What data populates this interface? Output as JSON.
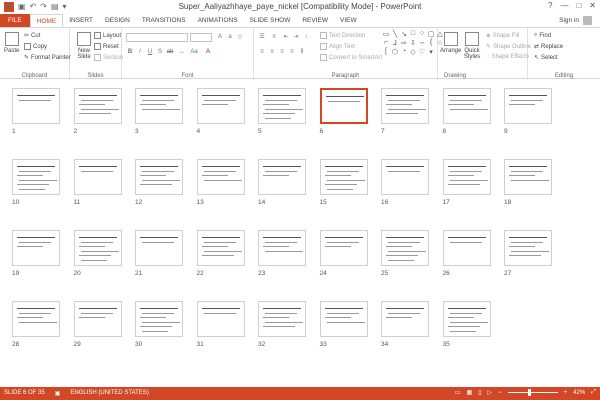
{
  "app": {
    "title": "Super_Aaliyazhhaye_paye_nickel [Compatibility Mode] - PowerPoint",
    "win_controls": [
      "?",
      "—",
      "□",
      "✕"
    ]
  },
  "tabs": [
    "FILE",
    "HOME",
    "INSERT",
    "DESIGN",
    "TRANSITIONS",
    "ANIMATIONS",
    "SLIDE SHOW",
    "REVIEW",
    "VIEW"
  ],
  "signin": "Sign in",
  "ribbon": {
    "clipboard": {
      "label": "Clipboard",
      "paste": "Paste",
      "cut": "Cut",
      "copy": "Copy",
      "format_painter": "Format Painter"
    },
    "slides": {
      "label": "Slides",
      "new_slide": "New Slide",
      "layout": "Layout",
      "reset": "Reset",
      "section": "Section"
    },
    "font": {
      "label": "Font"
    },
    "paragraph": {
      "label": "Paragraph",
      "text_direction": "Text Direction",
      "align_text": "Align Text",
      "convert_smartart": "Convert to SmartArt"
    },
    "drawing": {
      "label": "Drawing",
      "arrange": "Arrange",
      "quick_styles": "Quick Styles",
      "shape_fill": "Shape Fill",
      "shape_outline": "Shape Outline",
      "shape_effects": "Shape Effects"
    },
    "editing": {
      "label": "Editing",
      "find": "Find",
      "replace": "Replace",
      "select": "Select"
    }
  },
  "slides": [
    "1",
    "2",
    "3",
    "4",
    "5",
    "6",
    "7",
    "8",
    "9",
    "10",
    "11",
    "12",
    "13",
    "14",
    "15",
    "16",
    "17",
    "18",
    "19",
    "20",
    "21",
    "22",
    "23",
    "24",
    "25",
    "26",
    "27",
    "28",
    "29",
    "30",
    "31",
    "32",
    "33",
    "34",
    "35"
  ],
  "selected_slide": "6",
  "status": {
    "slide_info": "SLIDE 6 OF 35",
    "language": "ENGLISH (UNITED STATES)",
    "zoom": "42%"
  }
}
